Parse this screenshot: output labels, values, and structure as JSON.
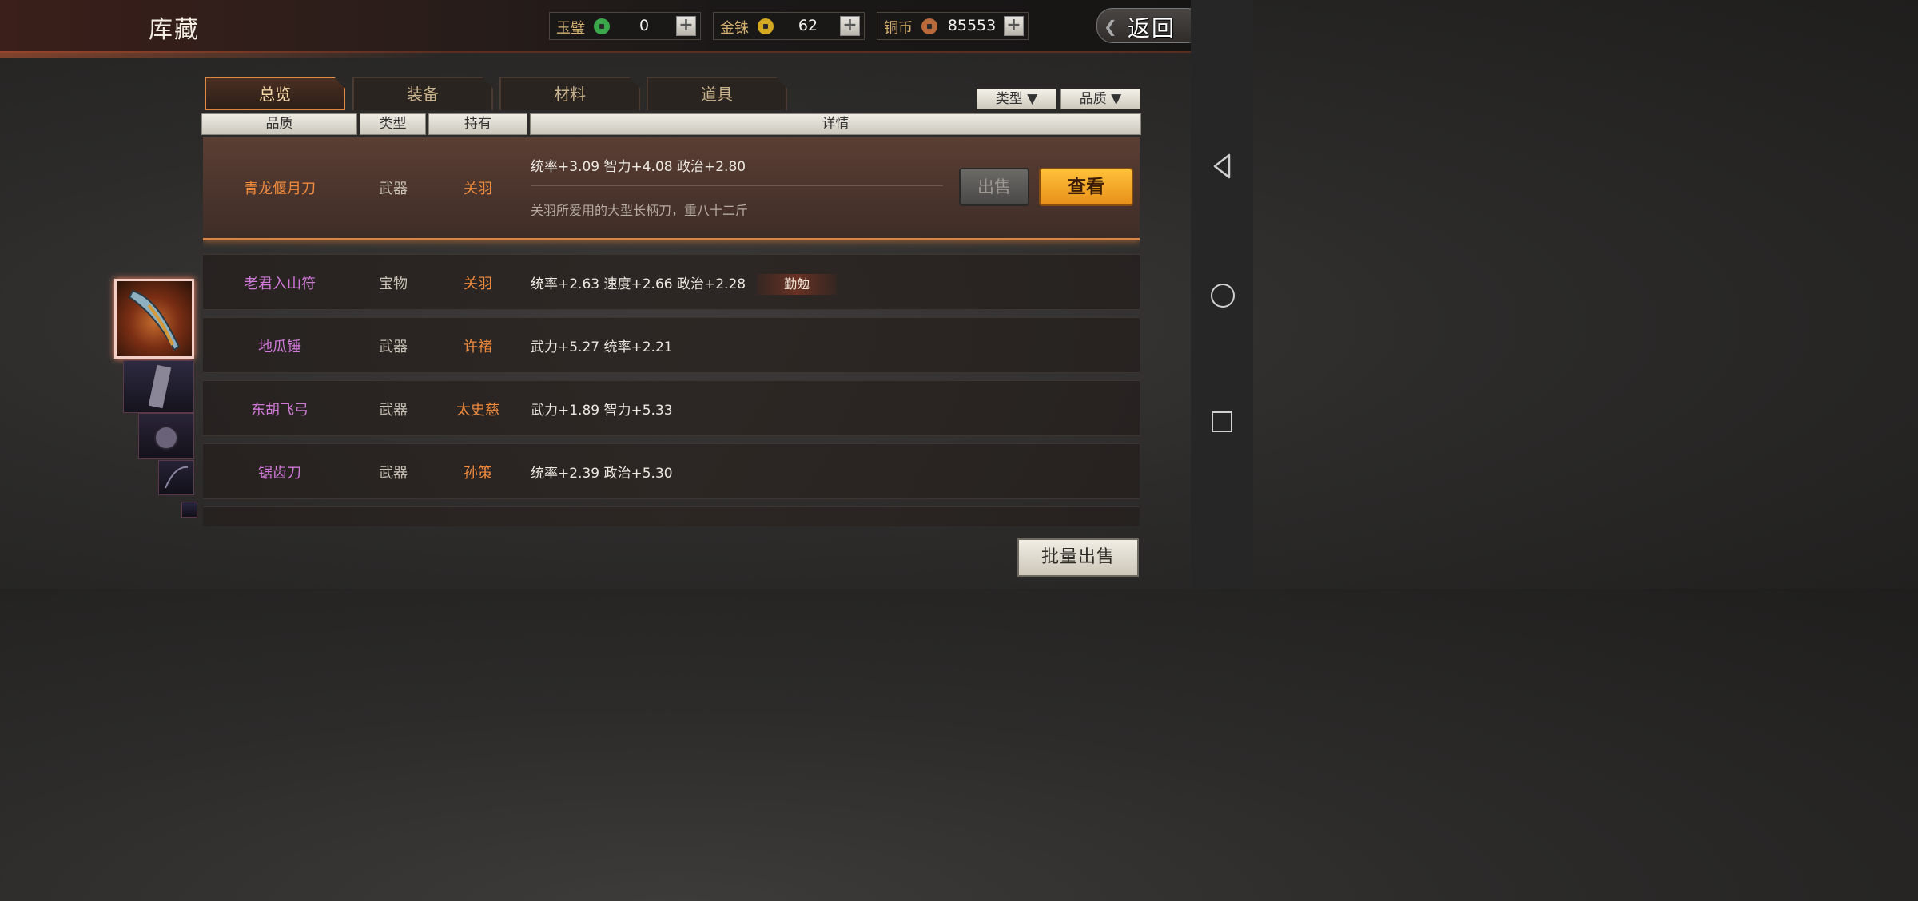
{
  "header": {
    "title": "库藏",
    "back_label": "返回",
    "currencies": [
      {
        "name": "玉璧",
        "value": "0",
        "coin_color": "#3aa84a"
      },
      {
        "name": "金铢",
        "value": "62",
        "coin_color": "#d4a820"
      },
      {
        "name": "铜币",
        "value": "85553",
        "coin_color": "#b86a3a"
      }
    ]
  },
  "tabs": [
    "总览",
    "装备",
    "材料",
    "道具"
  ],
  "active_tab": "总览",
  "filters": {
    "type": "类型",
    "quality": "品质"
  },
  "columns": [
    "品质",
    "类型",
    "持有",
    "详情"
  ],
  "items": [
    {
      "name": "青龙偃月刀",
      "type": "武器",
      "owner": "关羽",
      "detail": "统率+3.09   智力+4.08   政治+2.80",
      "description": "关羽所爱用的大型长柄刀，重八十二斤",
      "sell_label": "出售",
      "view_label": "查看"
    },
    {
      "name": "老君入山符",
      "type": "宝物",
      "owner": "关羽",
      "detail": "统率+2.63   速度+2.66   政治+2.28",
      "tag": "勤勉"
    },
    {
      "name": "地瓜锤",
      "type": "武器",
      "owner": "许褚",
      "detail": "武力+5.27   统率+2.21"
    },
    {
      "name": "东胡飞弓",
      "type": "武器",
      "owner": "太史慈",
      "detail": "武力+1.89   智力+5.33"
    },
    {
      "name": "锯齿刀",
      "type": "武器",
      "owner": "孙策",
      "detail": "统率+2.39   政治+5.30"
    }
  ],
  "batch_sell_label": "批量出售"
}
